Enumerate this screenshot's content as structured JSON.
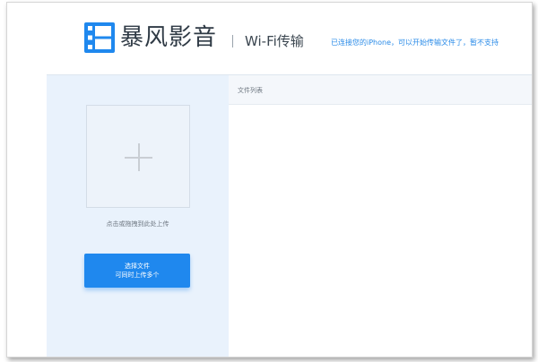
{
  "header": {
    "brand_name": "暴风影音",
    "subtitle": "Wi-Fi传输",
    "notice": "已连接您的iPhone，可以开始传输文件了，暂不支持",
    "logo_icon": "baofeng-film-logo-icon",
    "accent_color": "#1f88ee"
  },
  "upload": {
    "dropzone_icon": "plus-icon",
    "hint": "点击或拖拽到此处上传",
    "select_button": {
      "line1": "选择文件",
      "line2": "可同时上传多个"
    }
  },
  "file_list": {
    "title": "文件列表",
    "items": []
  }
}
